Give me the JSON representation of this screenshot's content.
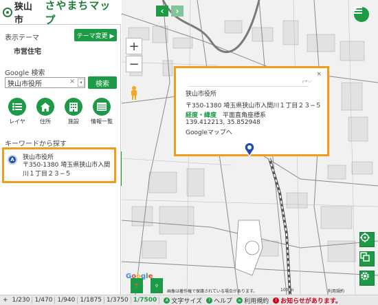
{
  "header": {
    "city": "狭山市",
    "app_title": "さやまちマップ"
  },
  "sidebar": {
    "theme_label": "表示テーマ",
    "theme_button": "テーマ変更 ▶",
    "theme_value": "市営住宅",
    "search_label": "Google 検索",
    "search_value": "狭山市役所",
    "search_clear": "×",
    "search_button": "検索",
    "categories": [
      {
        "label": "レイヤ",
        "icon": "list-icon"
      },
      {
        "label": "住所",
        "icon": "house-icon"
      },
      {
        "label": "施設",
        "icon": "building-icon"
      },
      {
        "label": "情報一覧",
        "icon": "table-icon"
      }
    ],
    "keyword_label": "キーワードから探す",
    "result": {
      "pin": "A",
      "name": "狭山市役所",
      "address": "〒350-1380 埼玉県狭山市入間川１丁目２３−５"
    },
    "collapse_icon": "«"
  },
  "map": {
    "zoom_in": "+",
    "zoom_out": "−",
    "popup": {
      "close": "×",
      "name": "狭山市役所",
      "address": "〒350-1380 埼玉県狭山市入間川１丁目２３−５",
      "coord_label": "経度・緯度",
      "coord_system": "平面直角座標系",
      "coords": "139.412213, 35.852948",
      "gmap_link": "Googleマップへ"
    },
    "google_logo": "Google",
    "attribution": "画像は著作権で保護されている場合があります。",
    "scale": "100 m",
    "terms": "利用規約"
  },
  "footer": {
    "plus": "+",
    "scales": [
      "1/230",
      "1/470",
      "1/940",
      "1/1875",
      "1/3750",
      "1/7500"
    ],
    "active_scale": "1/7500",
    "links": [
      "文字サイズ",
      "ヘルプ",
      "利用規約"
    ],
    "news": "お知らせがあります。"
  }
}
